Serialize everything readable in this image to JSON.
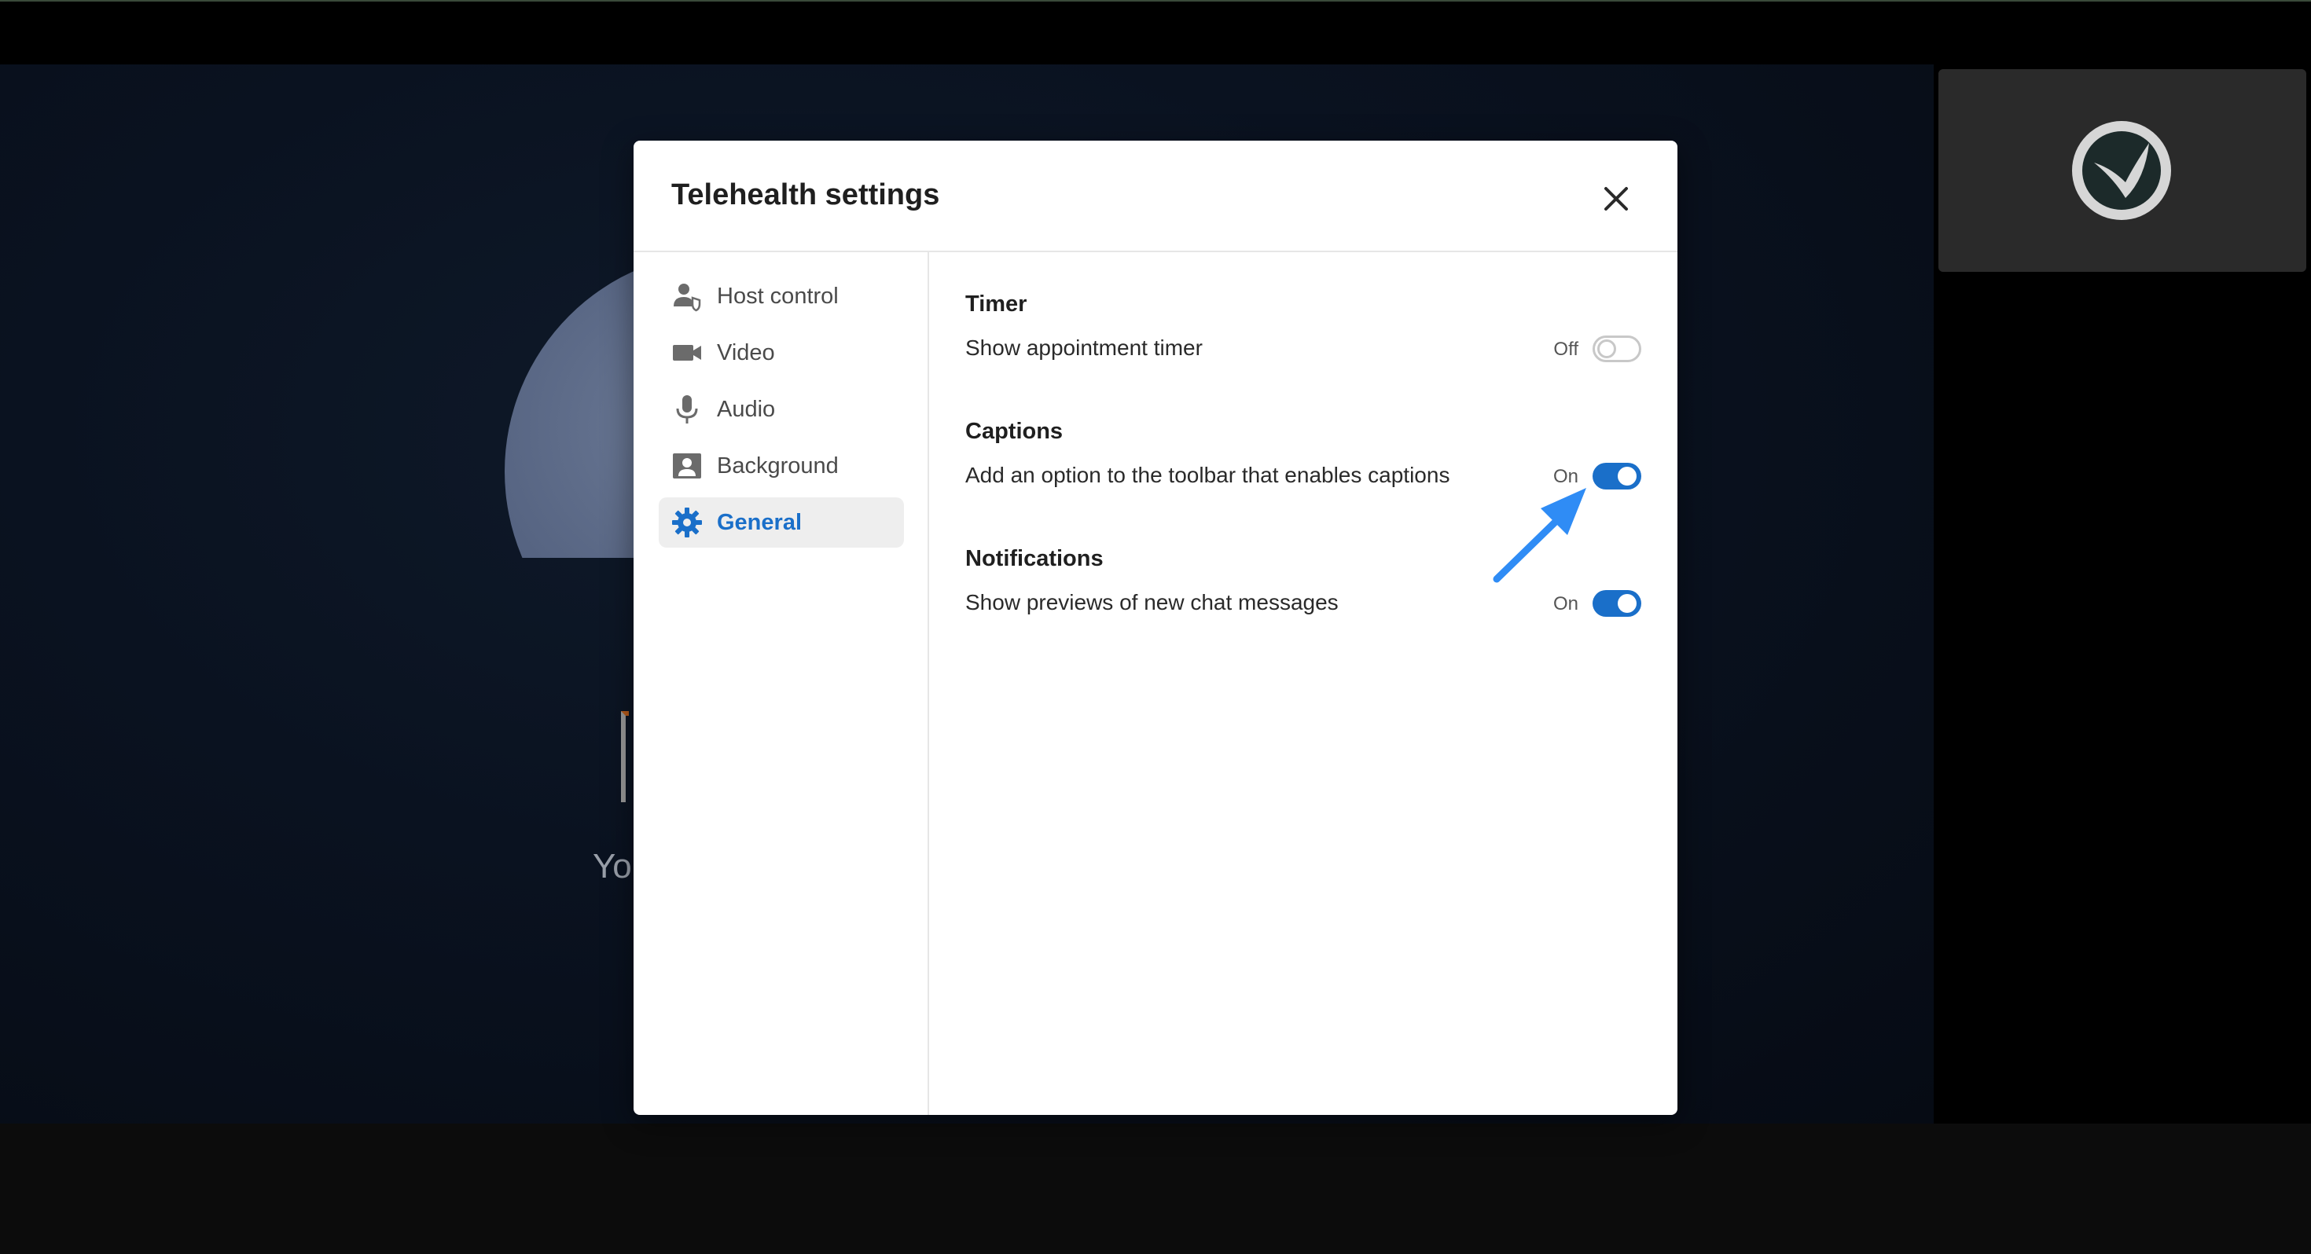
{
  "background": {
    "partial_text": "Yo"
  },
  "dialog": {
    "title": "Telehealth settings",
    "close_icon": "close-icon"
  },
  "sidebar": {
    "items": [
      {
        "label": "Host control",
        "icon": "host-control-icon",
        "active": false
      },
      {
        "label": "Video",
        "icon": "video-camera-icon",
        "active": false
      },
      {
        "label": "Audio",
        "icon": "microphone-icon",
        "active": false
      },
      {
        "label": "Background",
        "icon": "background-icon",
        "active": false
      },
      {
        "label": "General",
        "icon": "gear-icon",
        "active": true
      }
    ]
  },
  "settings": {
    "timer": {
      "title": "Timer",
      "label": "Show appointment timer",
      "state": "Off"
    },
    "captions": {
      "title": "Captions",
      "label": "Add an option to the toolbar that enables captions",
      "state": "On"
    },
    "notifications": {
      "title": "Notifications",
      "label": "Show previews of new chat messages",
      "state": "On"
    }
  },
  "colors": {
    "accent": "#1a6fc9",
    "annotation_arrow": "#2f8cf5"
  }
}
